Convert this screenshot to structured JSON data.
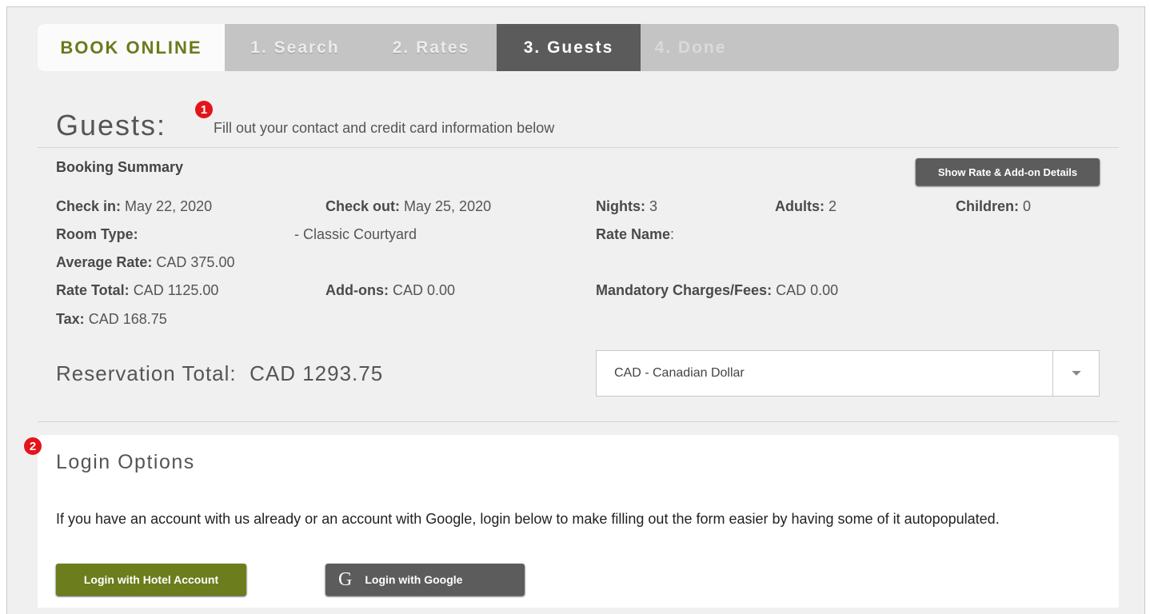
{
  "tabs": {
    "book_online": "BOOK ONLINE",
    "steps": [
      "1. Search",
      "2. Rates",
      "3. Guests",
      "4. Done"
    ],
    "active_index": 2
  },
  "badges": [
    "1",
    "2"
  ],
  "guests": {
    "title": "Guests:",
    "subtitle": "Fill out your contact and credit card information below"
  },
  "summary": {
    "title": "Booking Summary",
    "show_details_button": "Show Rate & Add-on Details",
    "check_in_label": "Check in:",
    "check_in_value": "May 22, 2020",
    "check_out_label": "Check out:",
    "check_out_value": "May 25, 2020",
    "nights_label": "Nights:",
    "nights_value": "3",
    "adults_label": "Adults:",
    "adults_value": "2",
    "children_label": "Children:",
    "children_value": "0",
    "room_type_label": "Room Type:",
    "room_type_value": "- Classic Courtyard",
    "rate_name_label": "Rate Name",
    "average_rate_label": "Average Rate:",
    "average_rate_value": "CAD 375.00",
    "rate_total_label": "Rate Total:",
    "rate_total_value": "CAD 1125.00",
    "addons_label": "Add-ons:",
    "addons_value": "CAD 0.00",
    "mandatory_label": "Mandatory Charges/Fees:",
    "mandatory_value": "CAD 0.00",
    "tax_label": "Tax:",
    "tax_value": "CAD 168.75",
    "reservation_total": "Reservation Total:  CAD 1293.75",
    "currency_selected": "CAD - Canadian Dollar"
  },
  "login": {
    "title": "Login Options",
    "text": "If you have an account with us already or an account with Google, login below to make filling out the form easier by having some of it autopopulated.",
    "hotel_button": "Login with Hotel Account",
    "google_button": "Login with Google",
    "google_glyph": "G"
  },
  "colors": {
    "accent_green": "#6b7d1c",
    "active_tab": "#5b5b5b",
    "badge_red": "#e3151a"
  }
}
